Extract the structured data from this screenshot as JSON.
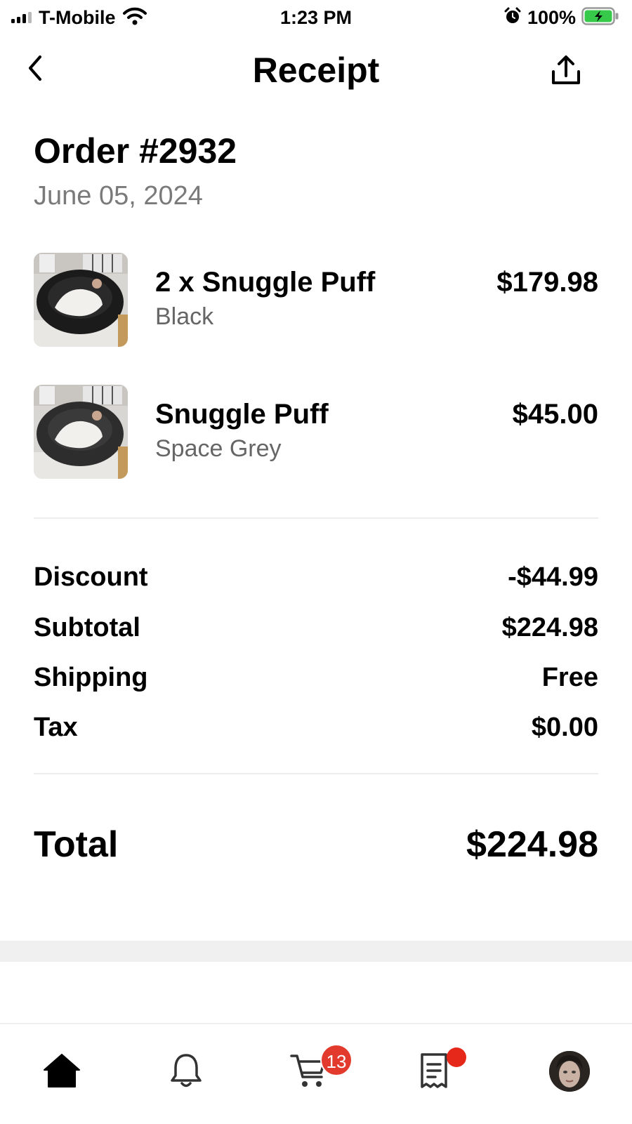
{
  "status_bar": {
    "carrier": "T-Mobile",
    "time": "1:23 PM",
    "battery": "100%",
    "icons": [
      "signal-icon",
      "wifi-icon",
      "alarm-icon",
      "battery-icon"
    ]
  },
  "nav": {
    "title": "Receipt",
    "back_icon": "chevron-left-icon",
    "share_icon": "share-icon"
  },
  "order": {
    "title": "Order #2932",
    "date": "June 05, 2024"
  },
  "items": [
    {
      "name": "2 x Snuggle Puff",
      "variant": "Black",
      "price": "$179.98"
    },
    {
      "name": "Snuggle Puff",
      "variant": "Space Grey",
      "price": "$45.00"
    }
  ],
  "summary": [
    {
      "label": "Discount",
      "value": "-$44.99"
    },
    {
      "label": "Subtotal",
      "value": "$224.98"
    },
    {
      "label": "Shipping",
      "value": "Free"
    },
    {
      "label": "Tax",
      "value": "$0.00"
    }
  ],
  "total": {
    "label": "Total",
    "value": "$224.98"
  },
  "tab_bar": {
    "tabs": [
      "home-icon",
      "bell-icon",
      "cart-icon",
      "receipt-icon",
      "avatar"
    ],
    "cart_badge": "13"
  },
  "colors": {
    "badge": "#e23b2e",
    "muted_text": "#7a7a7a",
    "divider": "#ededed"
  }
}
